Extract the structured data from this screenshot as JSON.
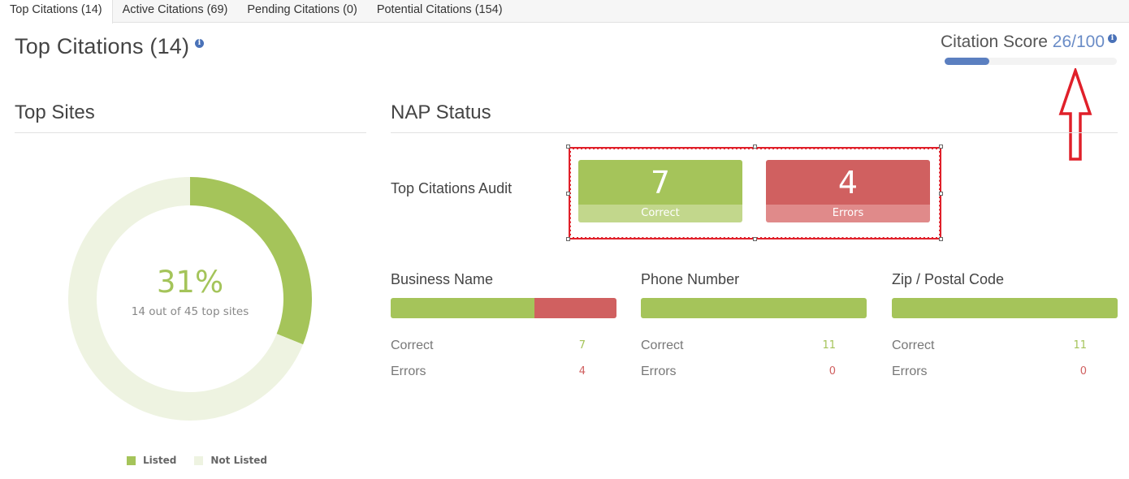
{
  "tabs": [
    {
      "label": "Top Citations (14)",
      "active": true
    },
    {
      "label": "Active Citations (69)",
      "active": false
    },
    {
      "label": "Pending Citations (0)",
      "active": false
    },
    {
      "label": "Potential Citations (154)",
      "active": false
    }
  ],
  "page_title": "Top Citations (14)",
  "info_icon_glyph": "i",
  "citation_score": {
    "label": "Citation Score",
    "value_text": "26/100",
    "value": 26,
    "max": 100
  },
  "top_sites": {
    "title": "Top Sites",
    "percent_text": "31%",
    "subtitle": "14 out of 45 top sites"
  },
  "nap_status": {
    "title": "NAP Status",
    "audit_label": "Top Citations Audit",
    "audit_cards": [
      {
        "value": "7",
        "label": "Correct"
      },
      {
        "value": "4",
        "label": "Errors"
      }
    ],
    "fields": [
      {
        "name": "Business Name",
        "correct_label": "Correct",
        "correct": 7,
        "errors_label": "Errors",
        "errors": 4
      },
      {
        "name": "Phone Number",
        "correct_label": "Correct",
        "correct": 11,
        "errors_label": "Errors",
        "errors": 0
      },
      {
        "name": "Zip / Postal Code",
        "correct_label": "Correct",
        "correct": 11,
        "errors_label": "Errors",
        "errors": 0
      }
    ]
  },
  "colors": {
    "green": "#a5c45a",
    "green_light": "#c2d78c",
    "red": "#d06060",
    "red_light": "#e08a8a",
    "not_listed": "#eef3e1",
    "score_blue": "#5b7fc0",
    "annotation_red": "#e0202a"
  },
  "chart_data": {
    "type": "pie",
    "title": "Top Sites",
    "center_label": "31%",
    "center_sublabel": "14 out of 45 top sites",
    "categories": [
      "Listed",
      "Not Listed"
    ],
    "values": [
      14,
      31
    ],
    "legend": "bottom"
  }
}
